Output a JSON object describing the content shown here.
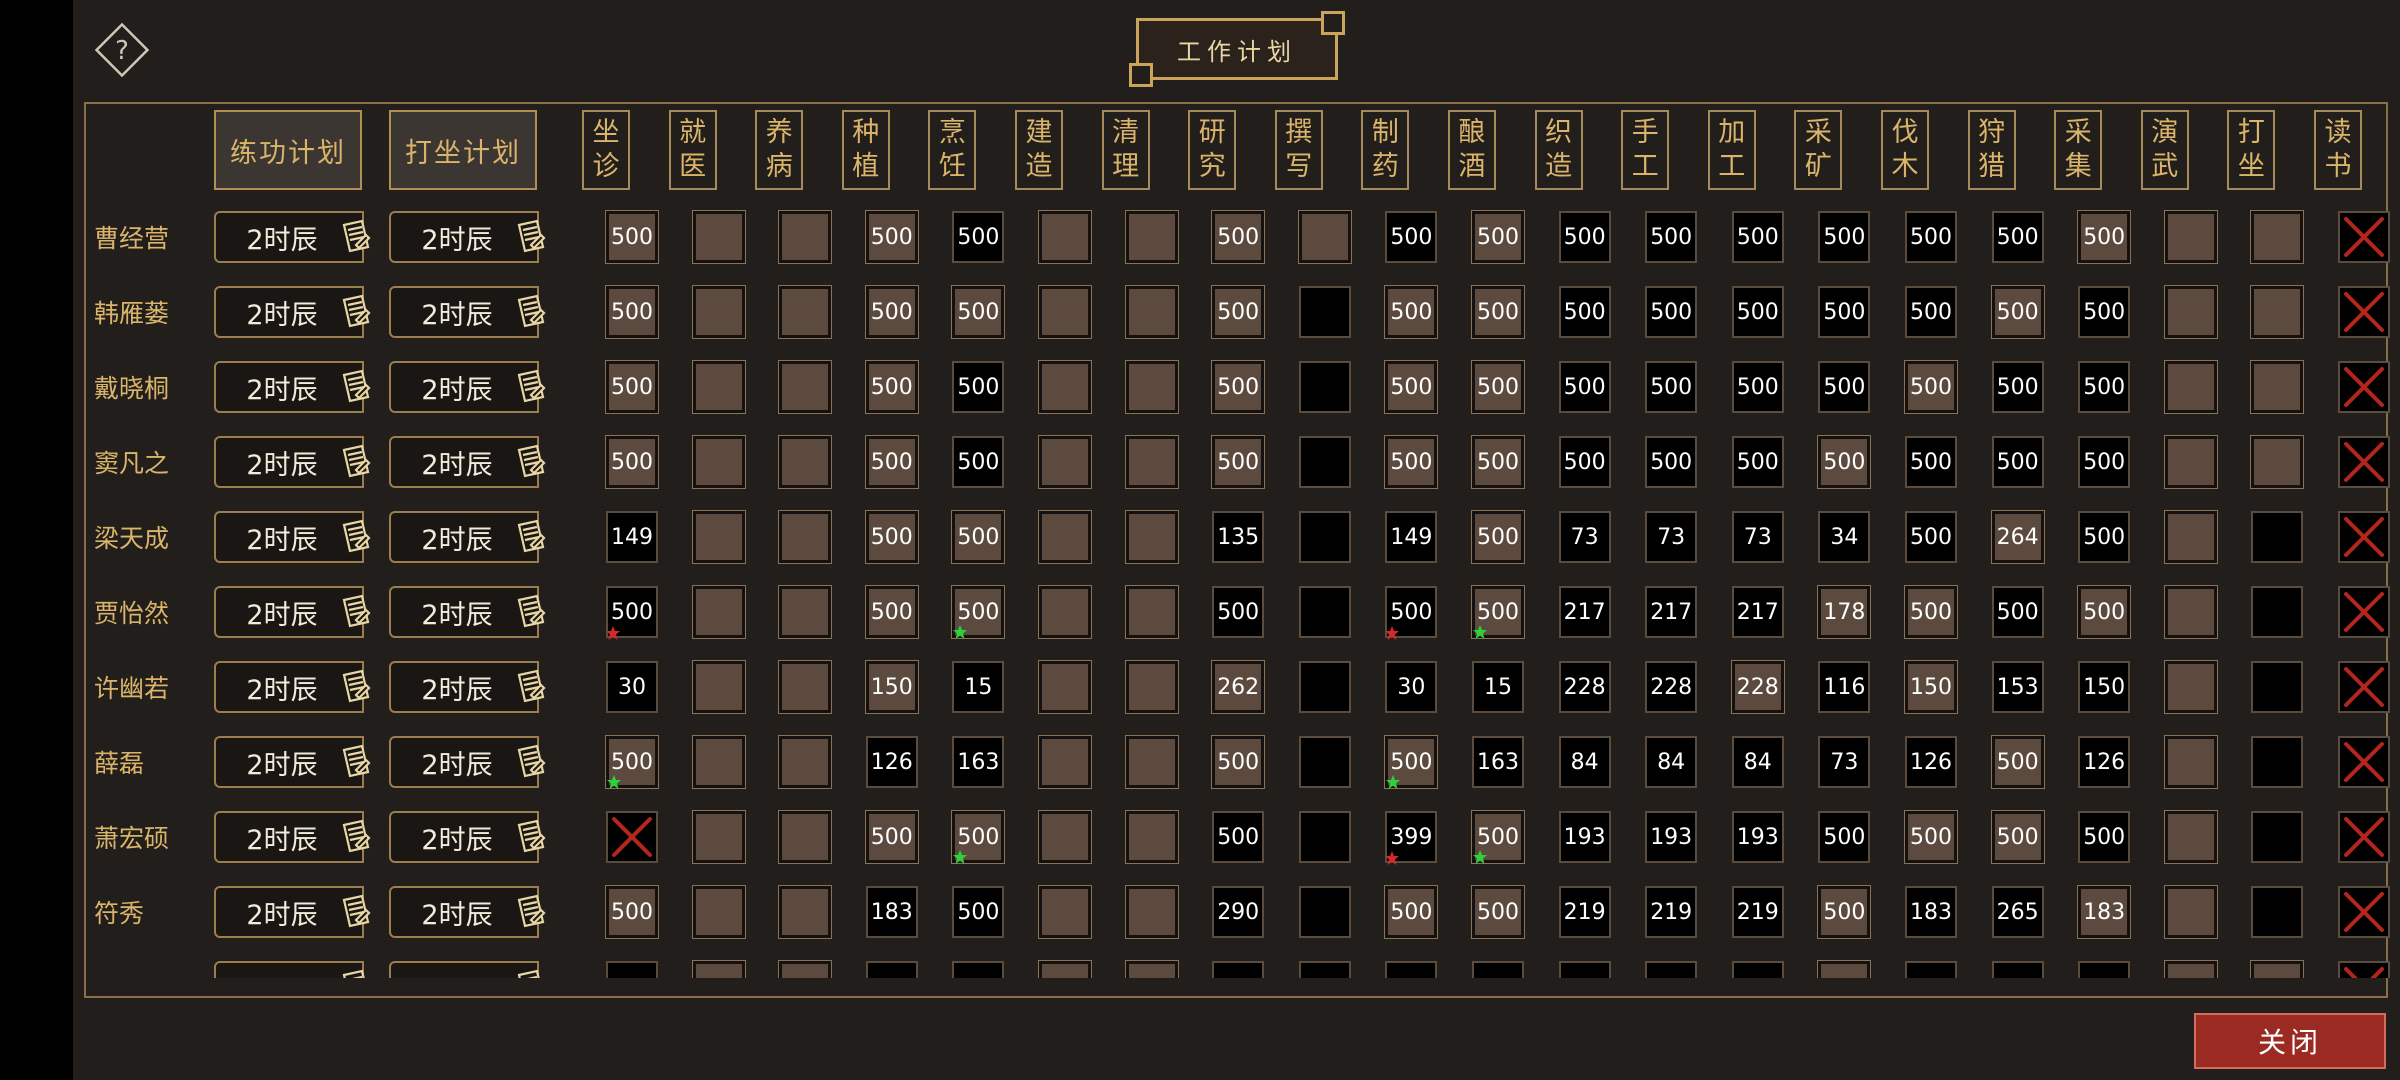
{
  "title": "工作计划",
  "close_label": "关闭",
  "plan_headers": [
    "练功计划",
    "打坐计划"
  ],
  "columns": [
    "坐诊",
    "就医",
    "养病",
    "种植",
    "烹饪",
    "建造",
    "清理",
    "研究",
    "撰写",
    "制药",
    "酿酒",
    "织造",
    "手工",
    "加工",
    "采矿",
    "伐木",
    "狩猎",
    "采集",
    "演武",
    "打坐",
    "读书"
  ],
  "legend": "cell t: b=brown slot, k=black slot, x=disabled; v=value; m=marker star (r=red, g=green)",
  "rows": [
    {
      "name": "曹经营",
      "plan1": "2时辰",
      "plan2": "2时辰",
      "cells": [
        {
          "t": "b",
          "v": "500"
        },
        {
          "t": "b"
        },
        {
          "t": "b"
        },
        {
          "t": "b",
          "v": "500"
        },
        {
          "t": "k",
          "v": "500"
        },
        {
          "t": "b"
        },
        {
          "t": "b"
        },
        {
          "t": "b",
          "v": "500"
        },
        {
          "t": "b"
        },
        {
          "t": "k",
          "v": "500"
        },
        {
          "t": "b",
          "v": "500"
        },
        {
          "t": "k",
          "v": "500"
        },
        {
          "t": "k",
          "v": "500"
        },
        {
          "t": "k",
          "v": "500"
        },
        {
          "t": "k",
          "v": "500"
        },
        {
          "t": "k",
          "v": "500"
        },
        {
          "t": "k",
          "v": "500"
        },
        {
          "t": "b",
          "v": "500"
        },
        {
          "t": "b"
        },
        {
          "t": "b"
        },
        {
          "t": "x"
        }
      ]
    },
    {
      "name": "韩雁蒌",
      "plan1": "2时辰",
      "plan2": "2时辰",
      "cells": [
        {
          "t": "b",
          "v": "500"
        },
        {
          "t": "b"
        },
        {
          "t": "b"
        },
        {
          "t": "b",
          "v": "500"
        },
        {
          "t": "b",
          "v": "500"
        },
        {
          "t": "b"
        },
        {
          "t": "b"
        },
        {
          "t": "b",
          "v": "500"
        },
        {
          "t": "k"
        },
        {
          "t": "b",
          "v": "500"
        },
        {
          "t": "b",
          "v": "500"
        },
        {
          "t": "k",
          "v": "500"
        },
        {
          "t": "k",
          "v": "500"
        },
        {
          "t": "k",
          "v": "500"
        },
        {
          "t": "k",
          "v": "500"
        },
        {
          "t": "k",
          "v": "500"
        },
        {
          "t": "b",
          "v": "500"
        },
        {
          "t": "k",
          "v": "500"
        },
        {
          "t": "b"
        },
        {
          "t": "b"
        },
        {
          "t": "x"
        }
      ]
    },
    {
      "name": "戴晓桐",
      "plan1": "2时辰",
      "plan2": "2时辰",
      "cells": [
        {
          "t": "b",
          "v": "500"
        },
        {
          "t": "b"
        },
        {
          "t": "b"
        },
        {
          "t": "b",
          "v": "500"
        },
        {
          "t": "k",
          "v": "500"
        },
        {
          "t": "b"
        },
        {
          "t": "b"
        },
        {
          "t": "b",
          "v": "500"
        },
        {
          "t": "k"
        },
        {
          "t": "b",
          "v": "500"
        },
        {
          "t": "b",
          "v": "500"
        },
        {
          "t": "k",
          "v": "500"
        },
        {
          "t": "k",
          "v": "500"
        },
        {
          "t": "k",
          "v": "500"
        },
        {
          "t": "k",
          "v": "500"
        },
        {
          "t": "b",
          "v": "500"
        },
        {
          "t": "k",
          "v": "500"
        },
        {
          "t": "k",
          "v": "500"
        },
        {
          "t": "b"
        },
        {
          "t": "b"
        },
        {
          "t": "x"
        }
      ]
    },
    {
      "name": "窦凡之",
      "plan1": "2时辰",
      "plan2": "2时辰",
      "cells": [
        {
          "t": "b",
          "v": "500"
        },
        {
          "t": "b"
        },
        {
          "t": "b"
        },
        {
          "t": "b",
          "v": "500"
        },
        {
          "t": "k",
          "v": "500"
        },
        {
          "t": "b"
        },
        {
          "t": "b"
        },
        {
          "t": "b",
          "v": "500"
        },
        {
          "t": "k"
        },
        {
          "t": "b",
          "v": "500"
        },
        {
          "t": "b",
          "v": "500"
        },
        {
          "t": "k",
          "v": "500"
        },
        {
          "t": "k",
          "v": "500"
        },
        {
          "t": "k",
          "v": "500"
        },
        {
          "t": "b",
          "v": "500"
        },
        {
          "t": "k",
          "v": "500"
        },
        {
          "t": "k",
          "v": "500"
        },
        {
          "t": "k",
          "v": "500"
        },
        {
          "t": "b"
        },
        {
          "t": "b"
        },
        {
          "t": "x"
        }
      ]
    },
    {
      "name": "梁天成",
      "plan1": "2时辰",
      "plan2": "2时辰",
      "cells": [
        {
          "t": "k",
          "v": "149"
        },
        {
          "t": "b"
        },
        {
          "t": "b"
        },
        {
          "t": "b",
          "v": "500"
        },
        {
          "t": "b",
          "v": "500"
        },
        {
          "t": "b"
        },
        {
          "t": "b"
        },
        {
          "t": "k",
          "v": "135"
        },
        {
          "t": "k"
        },
        {
          "t": "k",
          "v": "149"
        },
        {
          "t": "b",
          "v": "500"
        },
        {
          "t": "k",
          "v": "73"
        },
        {
          "t": "k",
          "v": "73"
        },
        {
          "t": "k",
          "v": "73"
        },
        {
          "t": "k",
          "v": "34"
        },
        {
          "t": "k",
          "v": "500"
        },
        {
          "t": "b",
          "v": "264"
        },
        {
          "t": "k",
          "v": "500"
        },
        {
          "t": "b"
        },
        {
          "t": "k"
        },
        {
          "t": "x"
        }
      ]
    },
    {
      "name": "贾怡然",
      "plan1": "2时辰",
      "plan2": "2时辰",
      "cells": [
        {
          "t": "k",
          "v": "500",
          "m": "r"
        },
        {
          "t": "b"
        },
        {
          "t": "b"
        },
        {
          "t": "b",
          "v": "500"
        },
        {
          "t": "b",
          "v": "500",
          "m": "g"
        },
        {
          "t": "b"
        },
        {
          "t": "b"
        },
        {
          "t": "k",
          "v": "500"
        },
        {
          "t": "k"
        },
        {
          "t": "k",
          "v": "500",
          "m": "r"
        },
        {
          "t": "b",
          "v": "500",
          "m": "g"
        },
        {
          "t": "k",
          "v": "217"
        },
        {
          "t": "k",
          "v": "217"
        },
        {
          "t": "k",
          "v": "217"
        },
        {
          "t": "b",
          "v": "178"
        },
        {
          "t": "b",
          "v": "500"
        },
        {
          "t": "k",
          "v": "500"
        },
        {
          "t": "b",
          "v": "500"
        },
        {
          "t": "b"
        },
        {
          "t": "k"
        },
        {
          "t": "x"
        }
      ]
    },
    {
      "name": "许幽若",
      "plan1": "2时辰",
      "plan2": "2时辰",
      "cells": [
        {
          "t": "k",
          "v": "30"
        },
        {
          "t": "b"
        },
        {
          "t": "b"
        },
        {
          "t": "b",
          "v": "150"
        },
        {
          "t": "k",
          "v": "15"
        },
        {
          "t": "b"
        },
        {
          "t": "b"
        },
        {
          "t": "b",
          "v": "262"
        },
        {
          "t": "k"
        },
        {
          "t": "k",
          "v": "30"
        },
        {
          "t": "k",
          "v": "15"
        },
        {
          "t": "k",
          "v": "228"
        },
        {
          "t": "k",
          "v": "228"
        },
        {
          "t": "b",
          "v": "228"
        },
        {
          "t": "k",
          "v": "116"
        },
        {
          "t": "b",
          "v": "150"
        },
        {
          "t": "k",
          "v": "153"
        },
        {
          "t": "k",
          "v": "150"
        },
        {
          "t": "b"
        },
        {
          "t": "k"
        },
        {
          "t": "x"
        }
      ]
    },
    {
      "name": "薛磊",
      "plan1": "2时辰",
      "plan2": "2时辰",
      "cells": [
        {
          "t": "b",
          "v": "500",
          "m": "g"
        },
        {
          "t": "b"
        },
        {
          "t": "b"
        },
        {
          "t": "k",
          "v": "126"
        },
        {
          "t": "k",
          "v": "163"
        },
        {
          "t": "b"
        },
        {
          "t": "b"
        },
        {
          "t": "b",
          "v": "500"
        },
        {
          "t": "k"
        },
        {
          "t": "b",
          "v": "500",
          "m": "g"
        },
        {
          "t": "k",
          "v": "163"
        },
        {
          "t": "k",
          "v": "84"
        },
        {
          "t": "k",
          "v": "84"
        },
        {
          "t": "k",
          "v": "84"
        },
        {
          "t": "k",
          "v": "73"
        },
        {
          "t": "k",
          "v": "126"
        },
        {
          "t": "b",
          "v": "500"
        },
        {
          "t": "k",
          "v": "126"
        },
        {
          "t": "b"
        },
        {
          "t": "k"
        },
        {
          "t": "x"
        }
      ]
    },
    {
      "name": "萧宏硕",
      "plan1": "2时辰",
      "plan2": "2时辰",
      "cells": [
        {
          "t": "x"
        },
        {
          "t": "b"
        },
        {
          "t": "b"
        },
        {
          "t": "b",
          "v": "500"
        },
        {
          "t": "b",
          "v": "500",
          "m": "g"
        },
        {
          "t": "b"
        },
        {
          "t": "b"
        },
        {
          "t": "k",
          "v": "500"
        },
        {
          "t": "k"
        },
        {
          "t": "k",
          "v": "399",
          "m": "r"
        },
        {
          "t": "b",
          "v": "500",
          "m": "g"
        },
        {
          "t": "k",
          "v": "193"
        },
        {
          "t": "k",
          "v": "193"
        },
        {
          "t": "k",
          "v": "193"
        },
        {
          "t": "k",
          "v": "500"
        },
        {
          "t": "b",
          "v": "500"
        },
        {
          "t": "b",
          "v": "500"
        },
        {
          "t": "k",
          "v": "500"
        },
        {
          "t": "b"
        },
        {
          "t": "k"
        },
        {
          "t": "x"
        }
      ]
    },
    {
      "name": "符秀",
      "plan1": "2时辰",
      "plan2": "2时辰",
      "cells": [
        {
          "t": "b",
          "v": "500"
        },
        {
          "t": "b"
        },
        {
          "t": "b"
        },
        {
          "t": "k",
          "v": "183"
        },
        {
          "t": "k",
          "v": "500"
        },
        {
          "t": "b"
        },
        {
          "t": "b"
        },
        {
          "t": "k",
          "v": "290"
        },
        {
          "t": "k"
        },
        {
          "t": "b",
          "v": "500"
        },
        {
          "t": "b",
          "v": "500"
        },
        {
          "t": "k",
          "v": "219"
        },
        {
          "t": "k",
          "v": "219"
        },
        {
          "t": "k",
          "v": "219"
        },
        {
          "t": "b",
          "v": "500"
        },
        {
          "t": "k",
          "v": "183"
        },
        {
          "t": "k",
          "v": "265"
        },
        {
          "t": "b",
          "v": "183"
        },
        {
          "t": "b"
        },
        {
          "t": "k"
        },
        {
          "t": "x"
        }
      ]
    },
    {
      "name": "",
      "plan1": "",
      "plan2": "",
      "cells": [
        {
          "t": "k"
        },
        {
          "t": "b"
        },
        {
          "t": "b"
        },
        {
          "t": "k"
        },
        {
          "t": "k"
        },
        {
          "t": "b"
        },
        {
          "t": "b"
        },
        {
          "t": "k"
        },
        {
          "t": "k"
        },
        {
          "t": "k"
        },
        {
          "t": "k"
        },
        {
          "t": "k"
        },
        {
          "t": "k"
        },
        {
          "t": "k"
        },
        {
          "t": "b"
        },
        {
          "t": "k"
        },
        {
          "t": "k"
        },
        {
          "t": "k"
        },
        {
          "t": "b"
        },
        {
          "t": "b"
        },
        {
          "t": "x"
        }
      ]
    }
  ],
  "colors": {
    "gold": "#d9b46a",
    "brown_slot": "#5c4a3e",
    "close_red": "#9a2a22",
    "star_red": "#d12a2a",
    "star_green": "#2fd23b"
  }
}
